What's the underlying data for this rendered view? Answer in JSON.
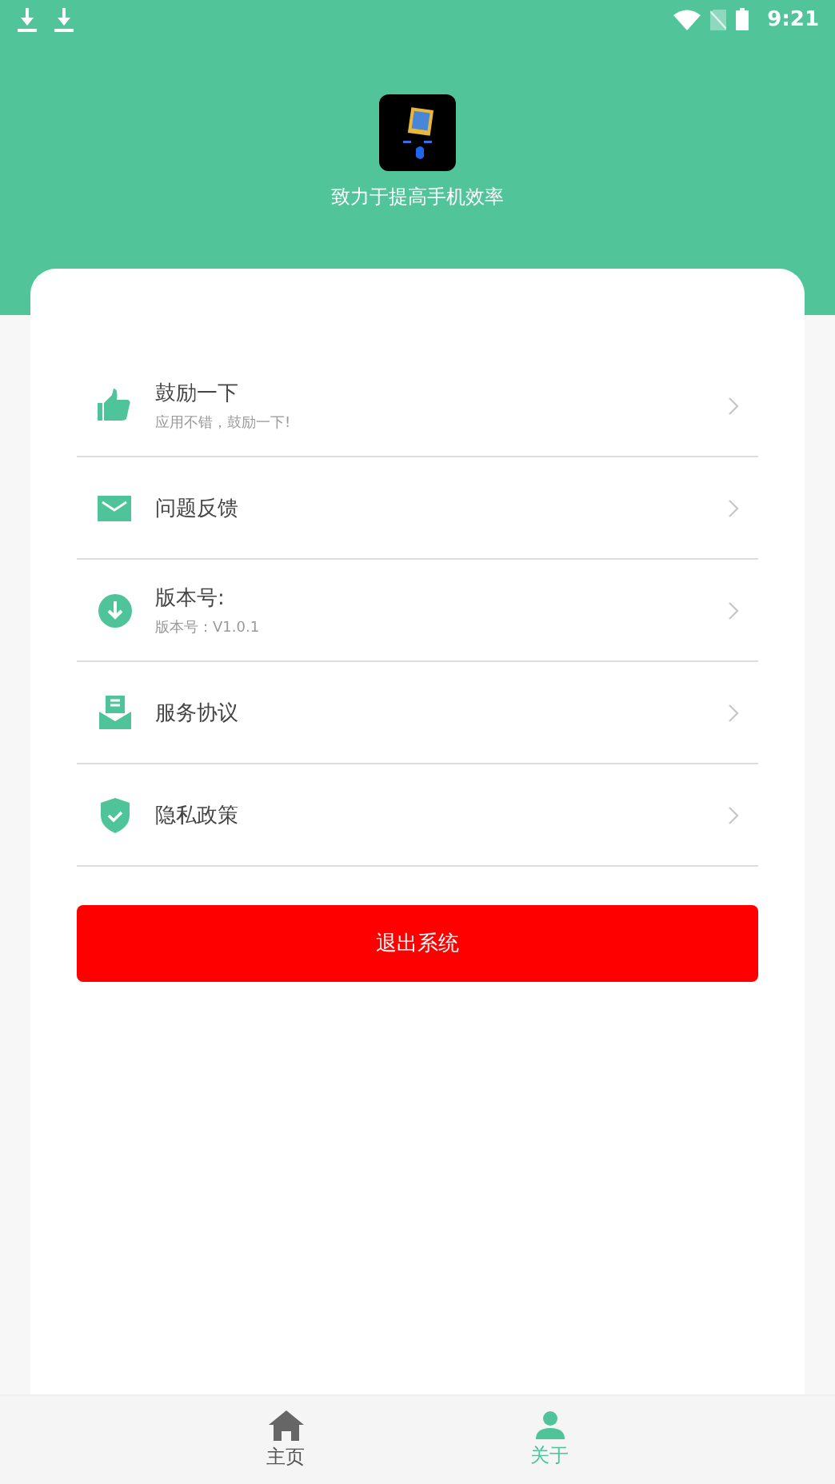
{
  "status_bar": {
    "time": "9:21"
  },
  "header": {
    "slogan": "致力于提高手机效率"
  },
  "menu": [
    {
      "title": "鼓励一下",
      "subtitle": "应用不错，鼓励一下!"
    },
    {
      "title": "问题反馈"
    },
    {
      "title": "版本号:",
      "subtitle": "版本号：V1.0.1"
    },
    {
      "title": "服务协议"
    },
    {
      "title": "隐私政策"
    }
  ],
  "logout_button": "退出系统",
  "tabs": [
    {
      "label": "主页",
      "selected": false
    },
    {
      "label": "关于",
      "selected": true
    }
  ]
}
